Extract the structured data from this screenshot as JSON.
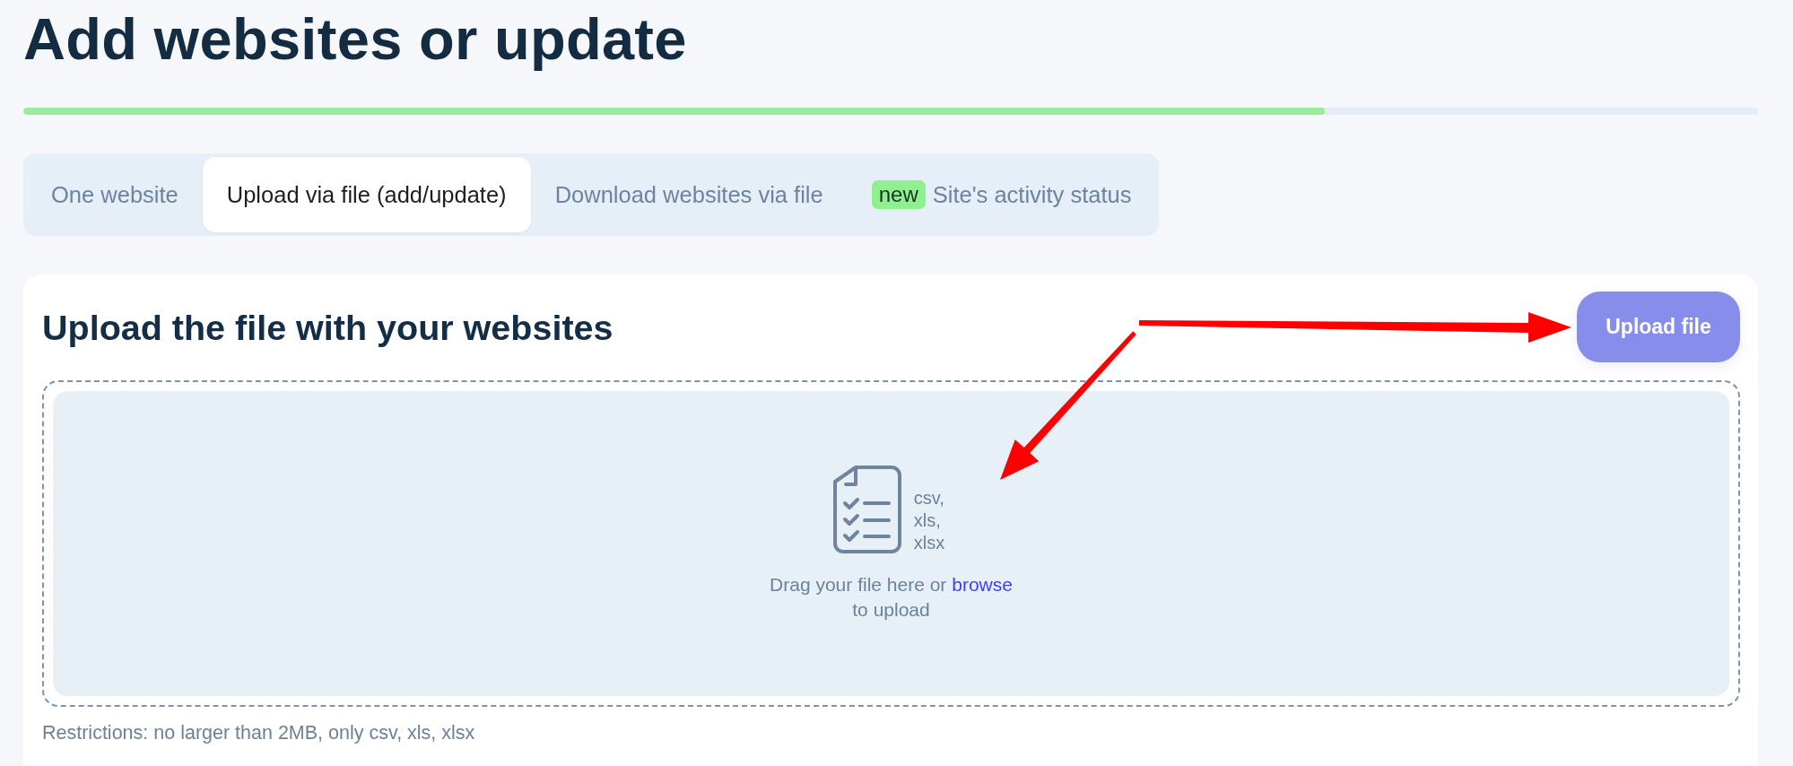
{
  "title": "Add websites or update",
  "progress": {
    "level": 0.75
  },
  "tabs": [
    {
      "label": "One website",
      "selected": false
    },
    {
      "label": "Upload via file (add/update)",
      "selected": true
    },
    {
      "label": "Download websites via file",
      "selected": false
    },
    {
      "label": "Site's activity status",
      "badge": "new",
      "selected": false
    }
  ],
  "upload_card": {
    "heading": "Upload the file with your websites",
    "upload_button": {
      "label": "Upload file",
      "disabled": true
    },
    "dropzone": {
      "formats": "csv, xls, xlsx",
      "prompt_before": "Drag your file here or",
      "link": "browse",
      "prompt_after": "to upload"
    },
    "restrictions": "Restrictions: no larger than 2MB, only csv, xls, xlsx"
  },
  "annotations": [
    {
      "kind": "arrow"
    },
    {
      "kind": "arrow"
    }
  ]
}
